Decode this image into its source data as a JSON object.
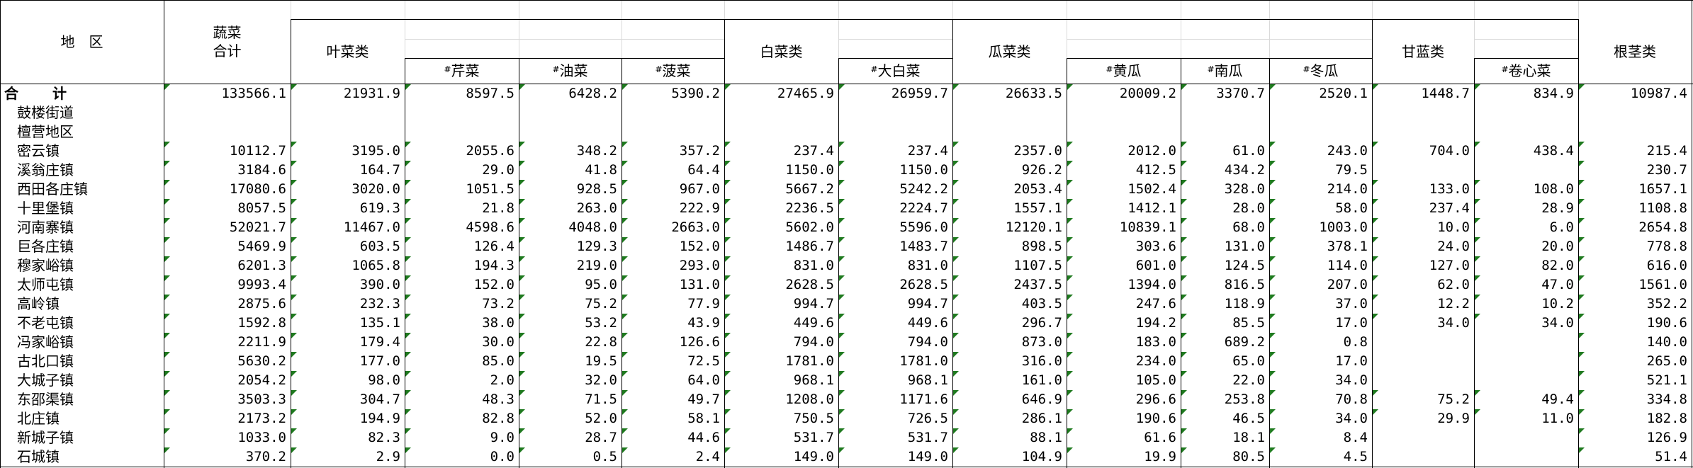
{
  "header": {
    "region": "地　区",
    "veg_total_line1": "蔬菜",
    "veg_total_line2": "合计",
    "leafy": "叶菜类",
    "celery": "芹菜",
    "rape": "油菜",
    "spinach": "菠菜",
    "cabbage_cls": "白菜类",
    "napa": "大白菜",
    "melon_cls": "瓜菜类",
    "cucumber": "黄瓜",
    "pumpkin": "南瓜",
    "wax_gourd": "冬瓜",
    "brassica": "甘蓝类",
    "roll_cabbage": "卷心菜",
    "root_cls": "根茎类",
    "mark": "#"
  },
  "rows": [
    {
      "name": "合　计",
      "total": true,
      "v": [
        "133566.1",
        "21931.9",
        "8597.5",
        "6428.2",
        "5390.2",
        "27465.9",
        "26959.7",
        "26633.5",
        "20009.2",
        "3370.7",
        "2520.1",
        "1448.7",
        "834.9",
        "10987.4"
      ]
    },
    {
      "name": "鼓楼街道",
      "v": [
        "",
        "",
        "",
        "",
        "",
        "",
        "",
        "",
        "",
        "",
        "",
        "",
        "",
        ""
      ]
    },
    {
      "name": "檀营地区",
      "v": [
        "",
        "",
        "",
        "",
        "",
        "",
        "",
        "",
        "",
        "",
        "",
        "",
        "",
        ""
      ]
    },
    {
      "name": "密云镇",
      "v": [
        "10112.7",
        "3195.0",
        "2055.6",
        "348.2",
        "357.2",
        "237.4",
        "237.4",
        "2357.0",
        "2012.0",
        "61.0",
        "243.0",
        "704.0",
        "438.4",
        "215.4"
      ]
    },
    {
      "name": "溪翁庄镇",
      "v": [
        "3184.6",
        "164.7",
        "29.0",
        "41.8",
        "64.4",
        "1150.0",
        "1150.0",
        "926.2",
        "412.5",
        "434.2",
        "79.5",
        "",
        "",
        "230.7"
      ]
    },
    {
      "name": "西田各庄镇",
      "v": [
        "17080.6",
        "3020.0",
        "1051.5",
        "928.5",
        "967.0",
        "5667.2",
        "5242.2",
        "2053.4",
        "1502.4",
        "328.0",
        "214.0",
        "133.0",
        "108.0",
        "1657.1"
      ]
    },
    {
      "name": "十里堡镇",
      "v": [
        "8057.5",
        "619.3",
        "21.8",
        "263.0",
        "222.9",
        "2236.5",
        "2224.7",
        "1557.1",
        "1412.1",
        "28.0",
        "58.0",
        "237.4",
        "28.9",
        "1108.8"
      ]
    },
    {
      "name": "河南寨镇",
      "v": [
        "52021.7",
        "11467.0",
        "4598.6",
        "4048.0",
        "2663.0",
        "5602.0",
        "5596.0",
        "12120.1",
        "10839.1",
        "68.0",
        "1003.0",
        "10.0",
        "6.0",
        "2654.8"
      ]
    },
    {
      "name": "巨各庄镇",
      "v": [
        "5469.9",
        "603.5",
        "126.4",
        "129.3",
        "152.0",
        "1486.7",
        "1483.7",
        "898.5",
        "303.6",
        "131.0",
        "378.1",
        "24.0",
        "20.0",
        "778.8"
      ]
    },
    {
      "name": "穆家峪镇",
      "v": [
        "6201.3",
        "1065.8",
        "194.3",
        "219.0",
        "293.0",
        "831.0",
        "831.0",
        "1107.5",
        "601.0",
        "124.5",
        "114.0",
        "127.0",
        "82.0",
        "616.0"
      ]
    },
    {
      "name": "太师屯镇",
      "v": [
        "9993.4",
        "390.0",
        "152.0",
        "95.0",
        "131.0",
        "2628.5",
        "2628.5",
        "2437.5",
        "1394.0",
        "816.5",
        "207.0",
        "62.0",
        "47.0",
        "1561.0"
      ]
    },
    {
      "name": "高岭镇",
      "v": [
        "2875.6",
        "232.3",
        "73.2",
        "75.2",
        "77.9",
        "994.7",
        "994.7",
        "403.5",
        "247.6",
        "118.9",
        "37.0",
        "12.2",
        "10.2",
        "352.2"
      ]
    },
    {
      "name": "不老屯镇",
      "v": [
        "1592.8",
        "135.1",
        "38.0",
        "53.2",
        "43.9",
        "449.6",
        "449.6",
        "296.7",
        "194.2",
        "85.5",
        "17.0",
        "34.0",
        "34.0",
        "190.6"
      ]
    },
    {
      "name": "冯家峪镇",
      "v": [
        "2211.9",
        "179.4",
        "30.0",
        "22.8",
        "126.6",
        "794.0",
        "794.0",
        "873.0",
        "183.0",
        "689.2",
        "0.8",
        "",
        "",
        "140.0"
      ]
    },
    {
      "name": "古北口镇",
      "v": [
        "5630.2",
        "177.0",
        "85.0",
        "19.5",
        "72.5",
        "1781.0",
        "1781.0",
        "316.0",
        "234.0",
        "65.0",
        "17.0",
        "",
        "",
        "265.0"
      ]
    },
    {
      "name": "大城子镇",
      "v": [
        "2054.2",
        "98.0",
        "2.0",
        "32.0",
        "64.0",
        "968.1",
        "968.1",
        "161.0",
        "105.0",
        "22.0",
        "34.0",
        "",
        "",
        "521.1"
      ]
    },
    {
      "name": "东邵渠镇",
      "v": [
        "3503.3",
        "304.7",
        "48.3",
        "71.5",
        "49.7",
        "1208.0",
        "1171.6",
        "646.9",
        "296.6",
        "253.8",
        "70.8",
        "75.2",
        "49.4",
        "334.8"
      ]
    },
    {
      "name": "北庄镇",
      "v": [
        "2173.2",
        "194.9",
        "82.8",
        "52.0",
        "58.1",
        "750.5",
        "726.5",
        "286.1",
        "190.6",
        "46.5",
        "34.0",
        "29.9",
        "11.0",
        "182.8"
      ]
    },
    {
      "name": "新城子镇",
      "v": [
        "1033.0",
        "82.3",
        "9.0",
        "28.7",
        "44.6",
        "531.7",
        "531.7",
        "88.1",
        "61.6",
        "18.1",
        "8.4",
        "",
        "",
        "126.9"
      ]
    },
    {
      "name": "石城镇",
      "v": [
        "370.2",
        "2.9",
        "0.0",
        "0.5",
        "2.4",
        "149.0",
        "149.0",
        "104.9",
        "19.9",
        "80.5",
        "4.5",
        "",
        "",
        "51.4"
      ]
    }
  ]
}
